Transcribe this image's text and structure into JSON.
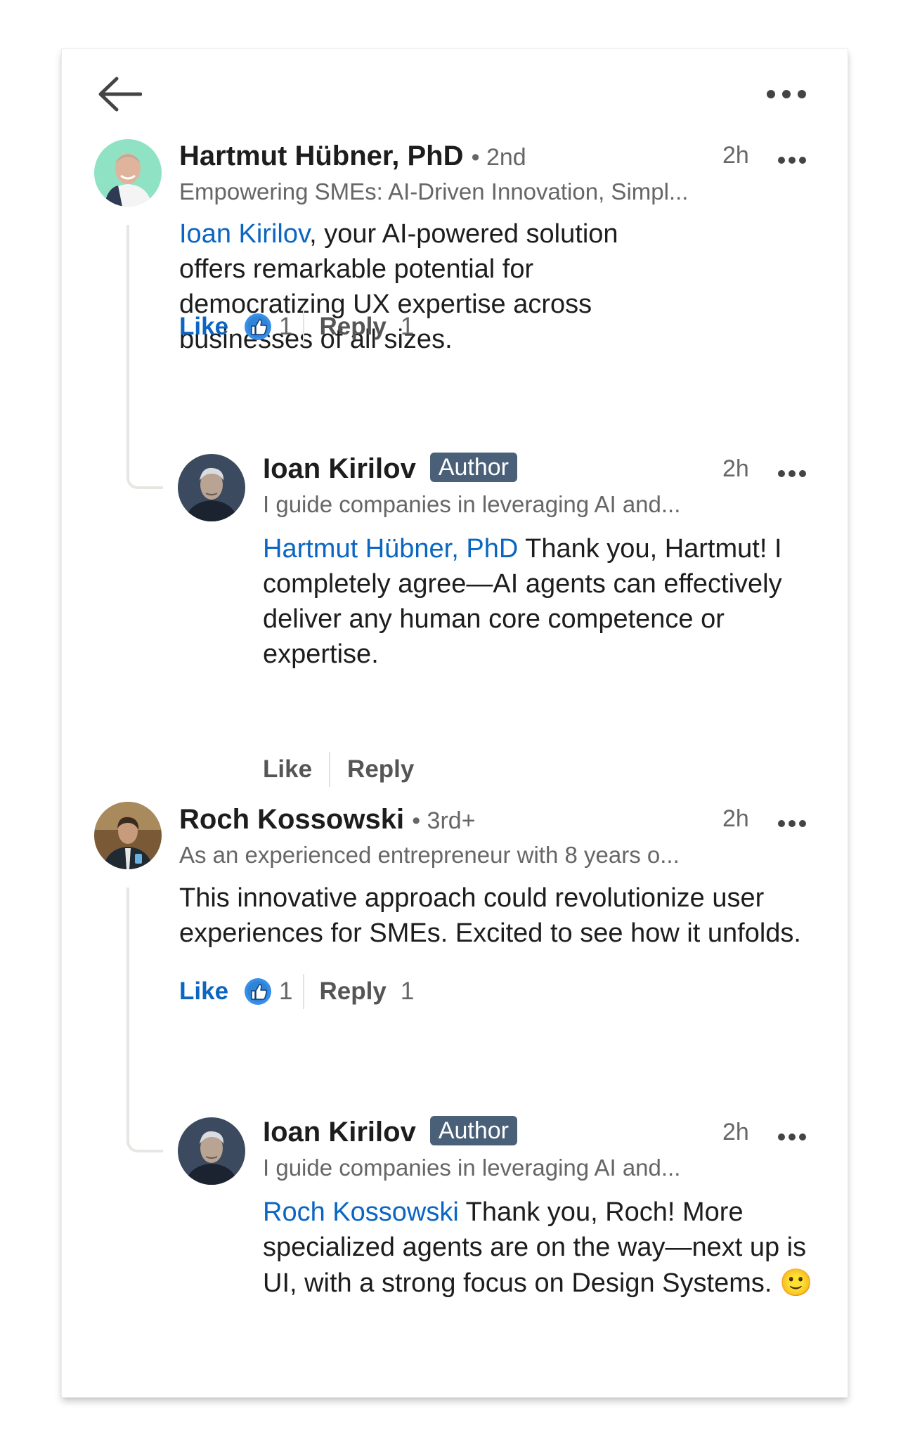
{
  "comments": [
    {
      "author": "Hartmut Hübner, PhD",
      "degree": "• 2nd",
      "headline": "Empowering SMEs: AI-Driven Innovation, Simpl...",
      "time": "2h",
      "mention": "Ioan Kirilov",
      "text": ", your AI-powered solution offers remarkable potential for democratizing UX expertise across businesses of all sizes.",
      "like_label": "Like",
      "like_count": "1",
      "reply_label": "Reply",
      "reply_count": "1",
      "reply": {
        "author": "Ioan Kirilov",
        "badge": "Author",
        "headline": "I guide companies in leveraging AI and...",
        "time": "2h",
        "mention": "Hartmut Hübner, PhD",
        "text": " Thank you, Hartmut! I completely agree—AI agents can effectively deliver any human core competence or expertise.",
        "like_label": "Like",
        "reply_label": "Reply"
      }
    },
    {
      "author": "Roch Kossowski",
      "degree": "• 3rd+",
      "headline": "As an experienced entrepreneur with 8 years o...",
      "time": "2h",
      "text": "This innovative approach could revolutionize user experiences for SMEs. Excited to see how it unfolds.",
      "like_label": "Like",
      "like_count": "1",
      "reply_label": "Reply",
      "reply_count": "1",
      "reply": {
        "author": "Ioan Kirilov",
        "badge": "Author",
        "headline": "I guide companies in leveraging AI and...",
        "time": "2h",
        "mention": "Roch Kossowski",
        "text": " Thank you, Roch! More specialized agents are on the way—next up is UI, with a strong focus on Design Systems. ",
        "emoji": "🙂"
      }
    }
  ],
  "colors": {
    "link": "#0a66c2",
    "badge": "#4a6078",
    "muted": "#666666"
  }
}
